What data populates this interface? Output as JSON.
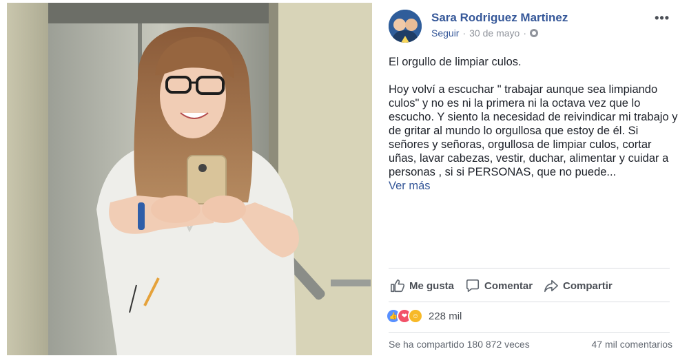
{
  "post": {
    "author": "Sara Rodriguez Martinez",
    "follow_label": "Seguir",
    "separator": "·",
    "date": "30 de mayo",
    "more_label": "•••",
    "title_line": "El orgullo de limpiar culos.",
    "body": "Hoy volví a escuchar \" trabajar aunque sea limpiando culos\" y no es ni la primera ni la octava vez que lo escucho. Y siento la necesidad de reivindicar mi trabajo y de gritar al mundo lo orgullosa que estoy de él. Si señores y señoras, orgullosa de limpiar culos, cortar uñas, lavar cabezas, vestir, duchar, alimentar y cuidar a personas , si si PERSONAS, que no puede...",
    "see_more": "Ver más"
  },
  "actions": {
    "like": "Me gusta",
    "comment": "Comentar",
    "share": "Compartir"
  },
  "stats": {
    "reaction_icons": [
      "like-icon",
      "love-icon",
      "haha-icon"
    ],
    "reaction_count": "228 mil",
    "shares": "Se ha compartido 180 872 veces",
    "comments": "47 mil comentarios"
  },
  "colors": {
    "link": "#365899",
    "text": "#1d2129",
    "muted": "#90949c",
    "like": "#5890ff",
    "love": "#f25268",
    "haha": "#f7b928"
  }
}
